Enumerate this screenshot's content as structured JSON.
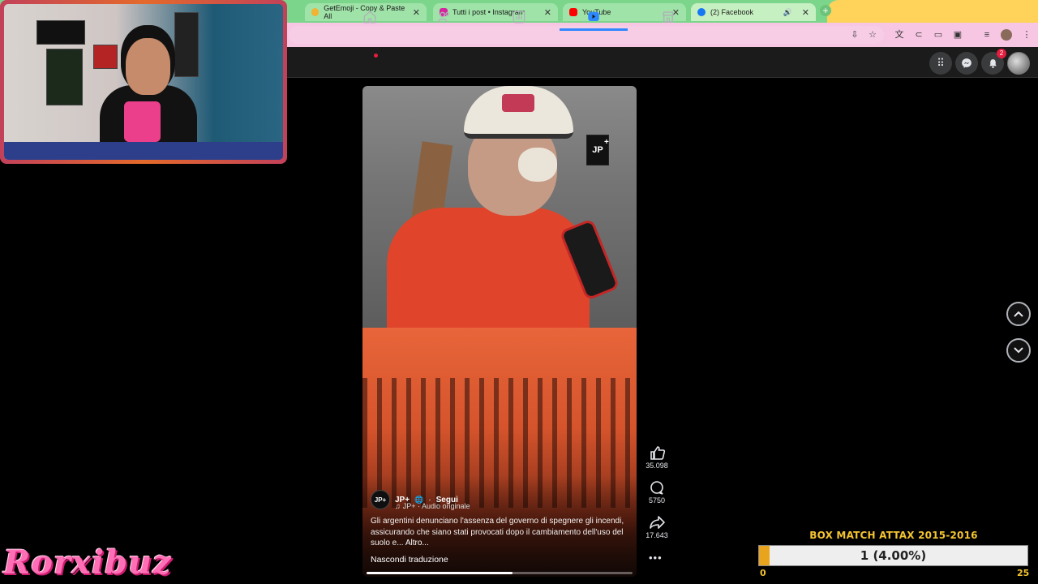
{
  "browser": {
    "tabs": [
      {
        "label": "GetEmoji - Copy & Paste All",
        "color": "#f2b233"
      },
      {
        "label": "Tutti i post • Instagram",
        "color": "#d6249f"
      },
      {
        "label": "YouTube",
        "color": "#ff0000"
      },
      {
        "label": "(2) Facebook",
        "color": "#1877f2"
      }
    ]
  },
  "fb": {
    "notification_count": "2",
    "active_nav": "video"
  },
  "reel": {
    "author": "JP+",
    "follow_label": "Segui",
    "audio": "JP+ · Audio originale",
    "caption": "Gli argentini denunciano l'assenza del governo di spegnere gli incendi, assicurando che siano stati provocati dopo il cambiamento dell'uso del suolo e...",
    "more_label": "Altro...",
    "hide_translation_label": "Nascondi traduzione",
    "badge_text": "JP",
    "progress_fraction": 0.55,
    "likes": "35.098",
    "comments": "5750",
    "shares": "17.643"
  },
  "overlay": {
    "logo_text": "Rorxibuz",
    "box_title": "BOX MATCH ATTAX 2015-2016",
    "box_label": "1 (4.00%)",
    "box_min": "0",
    "box_max": "25",
    "box_fraction": 0.04
  }
}
